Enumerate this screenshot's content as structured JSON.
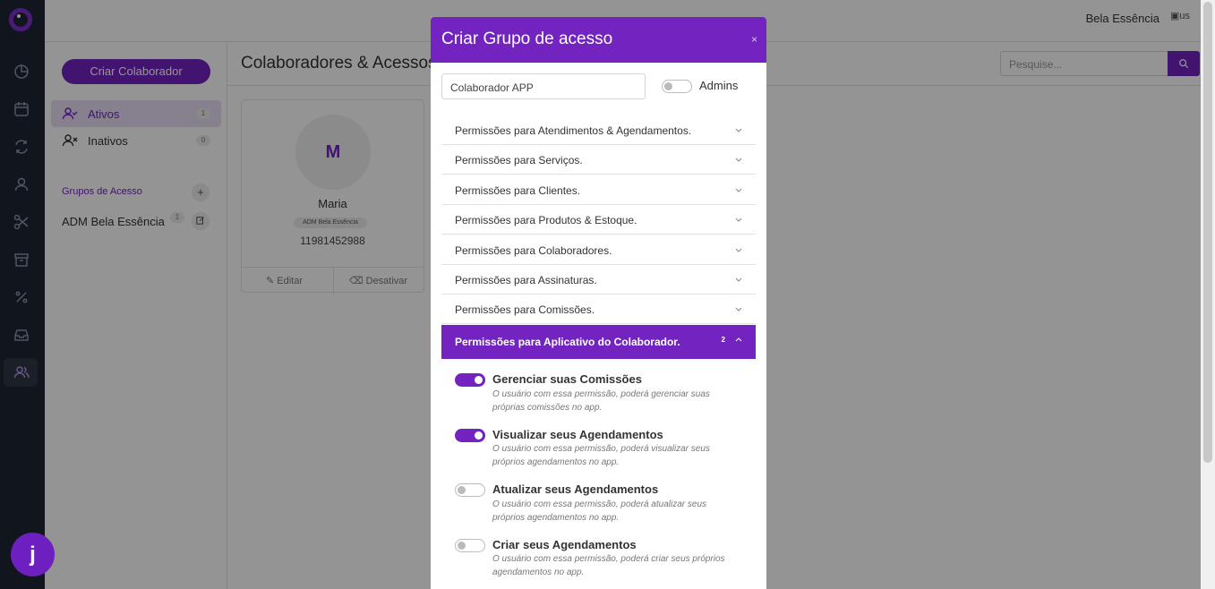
{
  "topbar": {
    "user_name": "Bela Essência",
    "avatar_alt": "us"
  },
  "leftnav": {
    "create_button": "Criar Colaborador",
    "items": [
      {
        "label": "Ativos",
        "count": "1"
      },
      {
        "label": "Inativos",
        "count": "0"
      }
    ],
    "groups_title": "Grupos de Acesso",
    "add_group": "+",
    "group": {
      "label": "ADM Bela Essência",
      "count": "1"
    }
  },
  "main": {
    "title": "Colaboradores & Acessos",
    "search_placeholder": "Pesquise...",
    "card": {
      "initial": "M",
      "name": "Maria",
      "role": "ADM Bela Essência",
      "phone": "11981452988",
      "edit": "Editar",
      "deactivate": "Desativar"
    }
  },
  "modal": {
    "title": "Criar Grupo de acesso",
    "close": "×",
    "name_value": "Colaborador APP",
    "admins_label": "Admins",
    "admins_enabled": false,
    "sections": [
      "Permissões para Atendimentos & Agendamentos.",
      "Permissões para Serviços.",
      "Permissões para Clientes.",
      "Permissões para Produtos & Estoque.",
      "Permissões para Colaboradores.",
      "Permissões para Assinaturas.",
      "Permissões para Comissões."
    ],
    "open_section": {
      "label": "Permissões para Aplicativo do Colaborador.",
      "count": "2"
    },
    "permissions": [
      {
        "title": "Gerenciar suas Comissões",
        "desc": "O usuário com essa permissão, poderá gerenciar suas próprias comissões no app.",
        "enabled": true
      },
      {
        "title": "Visualizar seus Agendamentos",
        "desc": "O usuário com essa permissão, poderá visualizar seus próprios agendamentos no app.",
        "enabled": true
      },
      {
        "title": "Atualizar seus Agendamentos",
        "desc": "O usuário com essa permissão, poderá atualizar seus próprios agendamentos no app.",
        "enabled": false
      },
      {
        "title": "Criar seus Agendamentos",
        "desc": "O usuário com essa permissão, poderá criar seus próprios agendamentos no app.",
        "enabled": false
      }
    ]
  },
  "fab": {
    "label": "j"
  },
  "colors": {
    "primary": "#7324c0",
    "sidebar": "#1e2533"
  }
}
